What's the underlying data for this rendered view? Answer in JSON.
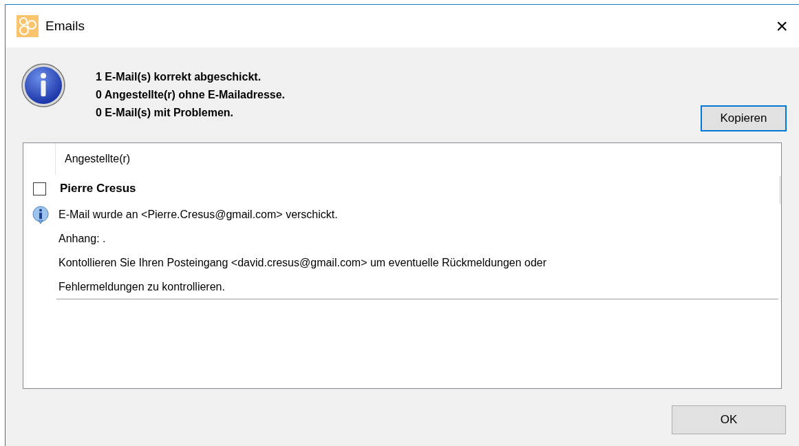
{
  "window": {
    "title": "Emails",
    "close": "×"
  },
  "summary": [
    "1 E-Mail(s) korrekt abgeschickt.",
    "0 Angestellte(r) ohne E-Mailadresse.",
    "0 E-Mail(s) mit Problemen."
  ],
  "copy_button": {
    "label": "Kopieren",
    "focused": true
  },
  "list": {
    "column": "Angestellte(r)",
    "items": [
      {
        "name": "Pierre Cresus",
        "checked": false,
        "lines": [
          "E-Mail wurde an <Pierre.Cresus@gmail.com> verschickt.",
          "Anhang: .",
          "Kontollieren Sie Ihren Posteingang <david.cresus@gmail.com> um eventuelle Rückmeldungen oder",
          "Fehlermeldungen zu kontrollieren."
        ]
      }
    ]
  },
  "ok_button": {
    "label": "OK"
  }
}
